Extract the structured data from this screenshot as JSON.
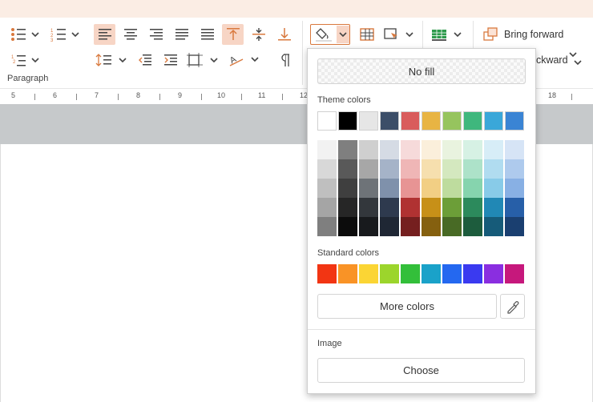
{
  "ribbon": {
    "group_label": "Paragraph",
    "bring_forward_label": "Bring forward",
    "send_backward_label": "ackward"
  },
  "ruler": {
    "labels": [
      "5",
      "6",
      "7",
      "8",
      "9",
      "10",
      "11",
      "12",
      "18"
    ]
  },
  "fill_popup": {
    "no_fill_label": "No fill",
    "theme_colors_label": "Theme colors",
    "theme_top_row": [
      "#ffffff",
      "#000000",
      "#e6e6e6",
      "#3c4e68",
      "#d95c5c",
      "#e8b443",
      "#96c45e",
      "#3fb77d",
      "#3aa7d9",
      "#3a84d4"
    ],
    "theme_shades": [
      [
        "#f2f2f2",
        "#7f7f7f",
        "#cfcfcf",
        "#d5dbe4",
        "#f6dada",
        "#fbefdb",
        "#e9f3df",
        "#d6f1e4",
        "#d7edf7",
        "#d6e4f6"
      ],
      [
        "#d8d8d8",
        "#595959",
        "#a7a7a7",
        "#a5b3c8",
        "#efb6b6",
        "#f6dfae",
        "#d4e8bf",
        "#ade2c9",
        "#b0dcf0",
        "#aecaed"
      ],
      [
        "#bfbfbf",
        "#3f3f3f",
        "#6e7378",
        "#7f91ab",
        "#e79494",
        "#f2cf84",
        "#bedc9e",
        "#86d4ae",
        "#88cbe8",
        "#88b0e4"
      ],
      [
        "#a5a5a5",
        "#262626",
        "#33373c",
        "#2e3a4e",
        "#b03232",
        "#c79018",
        "#6c9e38",
        "#2c8a5c",
        "#2188b5",
        "#275fa8"
      ],
      [
        "#7f7f7f",
        "#0c0c0c",
        "#181a1d",
        "#1f2734",
        "#751f1f",
        "#85600f",
        "#486a25",
        "#1d5c3d",
        "#165b79",
        "#1a3f70"
      ]
    ],
    "standard_colors_label": "Standard colors",
    "standard_colors": [
      "#f23513",
      "#f99326",
      "#fbd534",
      "#9cd52c",
      "#33bf3a",
      "#1aa2c9",
      "#2468f0",
      "#3a3af0",
      "#8a2ee0",
      "#c6187c"
    ],
    "more_colors_label": "More colors",
    "image_label": "Image",
    "choose_label": "Choose"
  }
}
